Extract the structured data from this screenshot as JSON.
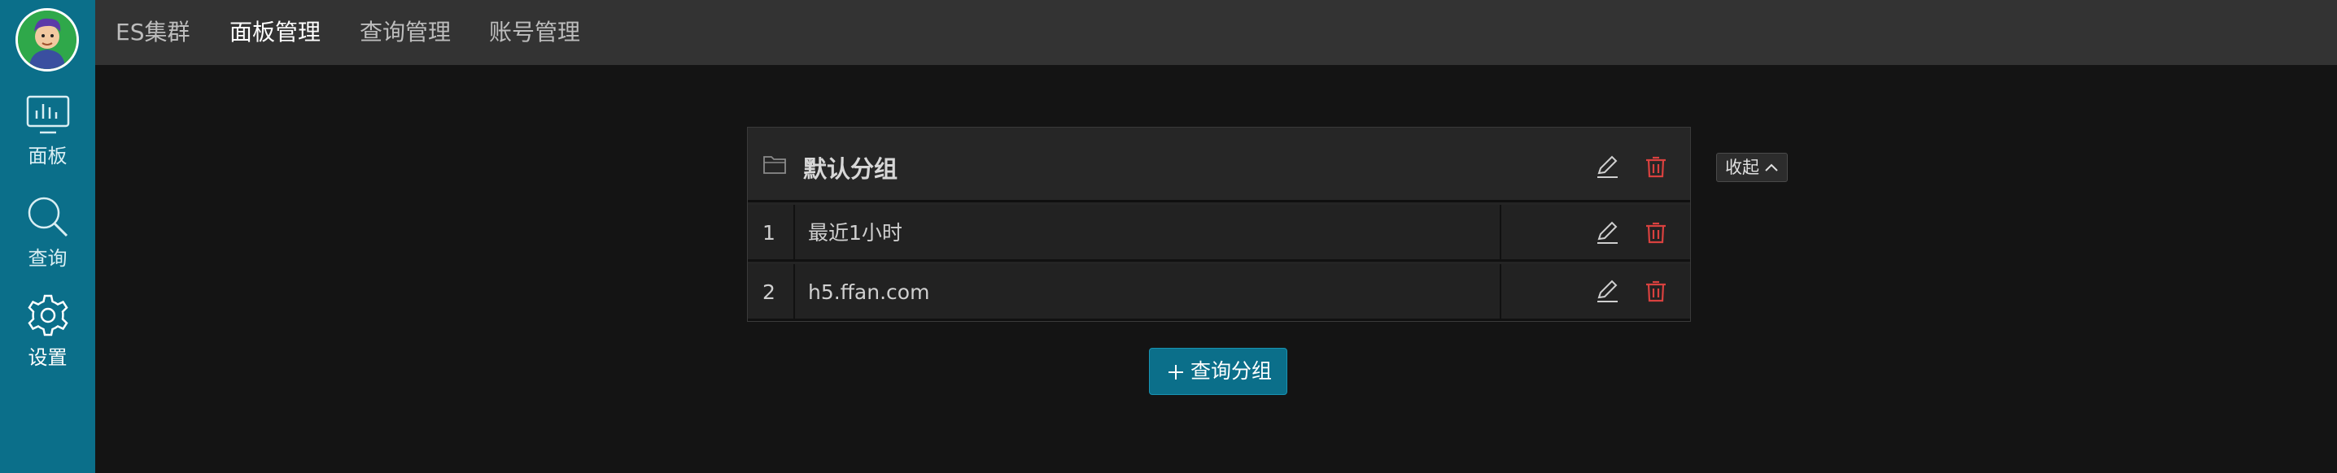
{
  "sidebar": {
    "items": [
      {
        "label": "面板",
        "icon": "dashboard-icon"
      },
      {
        "label": "查询",
        "icon": "search-icon"
      },
      {
        "label": "设置",
        "icon": "gear-icon"
      }
    ],
    "active": "设置"
  },
  "nav": {
    "items": [
      "ES集群",
      "面板管理",
      "查询管理",
      "账号管理"
    ],
    "active": "面板管理"
  },
  "group": {
    "title": "默认分组",
    "rows": [
      {
        "index": "1",
        "name": "最近1小时"
      },
      {
        "index": "2",
        "name": "h5.ffan.com"
      }
    ]
  },
  "collapse_label": "收起",
  "add_label": "查询分组",
  "colors": {
    "sidebar": "#0b6f8a",
    "topbar": "#333333",
    "background": "#141414",
    "delete": "#d9413f"
  }
}
